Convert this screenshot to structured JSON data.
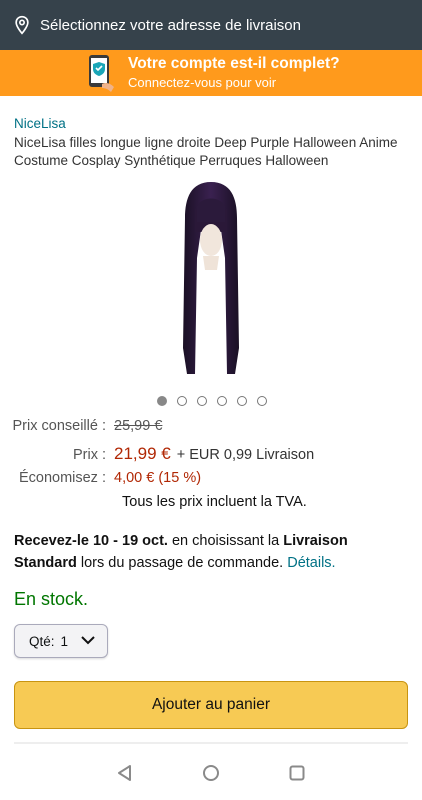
{
  "address_bar": {
    "label": "Sélectionnez votre adresse de livraison",
    "icon": "location-pin-icon"
  },
  "promo": {
    "title": "Votre compte est-il complet?",
    "subtitle": "Connectez-vous pour voir",
    "icon": "phone-shield-icon"
  },
  "product": {
    "brand": "NiceLisa",
    "title": "NiceLisa filles longue ligne droite Deep Purple Halloween Anime Costume Cosplay Synthétique Perruques Halloween",
    "image_count": 6,
    "active_image": 1
  },
  "pricing": {
    "list_label": "Prix conseillé :",
    "list_price": "25,99 €",
    "price_label": "Prix :",
    "price": "21,99 €",
    "shipping": "+ EUR 0,99 Livraison",
    "savings_label": "Économisez :",
    "savings": "4,00 € (15 %)",
    "tax_note": "Tous les prix incluent la TVA."
  },
  "delivery": {
    "receive": "Recevez-le 10 -  19 oct.",
    "text1": " en choisissant la ",
    "option": "Livraison Standard",
    "text2": " lors du passage de commande. ",
    "details_link": "Détails."
  },
  "stock": "En stock.",
  "quantity": {
    "label": "Qté:",
    "value": "1"
  },
  "add_to_cart": "Ajouter au panier",
  "nav": {
    "back": "back-triangle-icon",
    "home": "home-circle-icon",
    "recents": "recents-square-icon"
  },
  "colors": {
    "header": "#36424b",
    "promo": "#ff9a1c",
    "price": "#b12704",
    "link": "#007185",
    "stock": "#007600",
    "button": "#f7ca54"
  }
}
